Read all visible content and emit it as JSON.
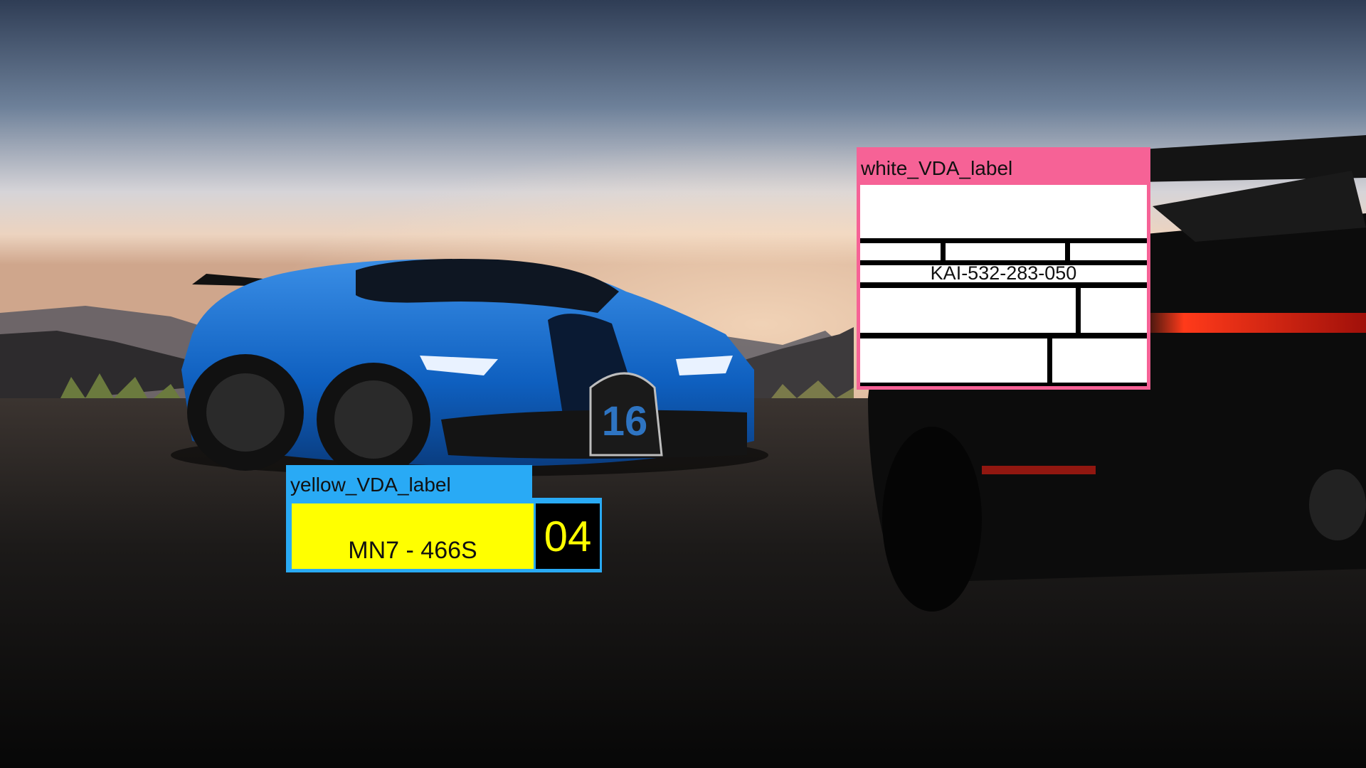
{
  "annotations": {
    "yellow": {
      "label": "yellow_VDA_label",
      "plate_text": "MN7 - 466S",
      "code": "04",
      "header_color": "#29aaf5",
      "plate_color": "#ffff00"
    },
    "white": {
      "label": "white_VDA_label",
      "id_text": "KAI-532-283-050",
      "header_color": "#f66296"
    }
  },
  "scene": {
    "subjects": [
      "blue sports car",
      "dark sports car rear"
    ],
    "car_badge_number": "16"
  }
}
